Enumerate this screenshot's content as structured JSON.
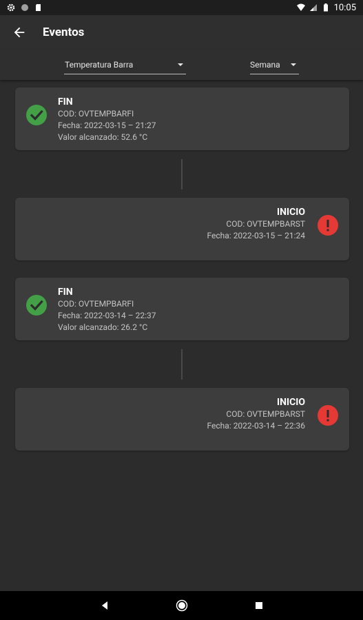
{
  "status_bar": {
    "time": "10:05"
  },
  "app_bar": {
    "title": "Eventos"
  },
  "filters": {
    "sensor": {
      "selected": "Temperatura Barra"
    },
    "period": {
      "selected": "Semana"
    }
  },
  "events": [
    {
      "type": "FIN",
      "side": "left",
      "status": "ok",
      "cod": "COD: OVTEMPBARFI",
      "fecha": "Fecha: 2022-03-15 – 21:27",
      "valor": "Valor alcanzado: 52.6 °C"
    },
    {
      "type": "INICIO",
      "side": "right",
      "status": "alert",
      "cod": "COD: OVTEMPBARST",
      "fecha": "Fecha: 2022-03-15 – 21:24"
    },
    {
      "type": "FIN",
      "side": "left",
      "status": "ok",
      "cod": "COD: OVTEMPBARFI",
      "fecha": "Fecha: 2022-03-14 – 22:37",
      "valor": "Valor alcanzado: 26.2 °C"
    },
    {
      "type": "INICIO",
      "side": "right",
      "status": "alert",
      "cod": "COD: OVTEMPBARST",
      "fecha": "Fecha: 2022-03-14 – 22:36"
    }
  ],
  "colors": {
    "ok": "#43a047",
    "alert": "#e53935",
    "card": "#3d3d3d",
    "background": "#2c2c2c"
  },
  "icons": {
    "ok": "check-circle-icon",
    "alert": "exclamation-circle-icon"
  }
}
